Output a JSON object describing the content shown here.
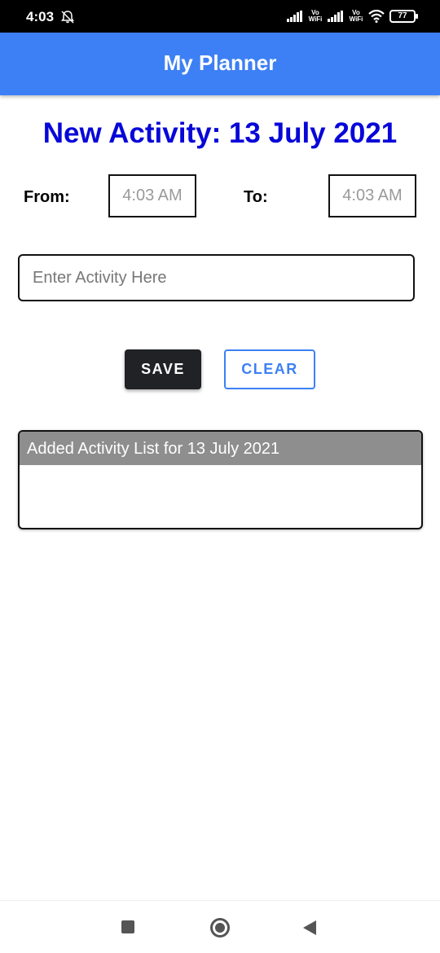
{
  "status_bar": {
    "time": "4:03",
    "vowifi_1": "Vo\nWiFi",
    "vowifi_2": "Vo\nWiFi",
    "battery": "77",
    "icons": [
      "bell-off-icon",
      "signal-icon",
      "wifi-icon",
      "battery-icon"
    ]
  },
  "app_bar": {
    "title": "My Planner",
    "color": "#3d80f5"
  },
  "heading": {
    "text": "New Activity: 13 July 2021",
    "color": "#0707d9"
  },
  "time_range": {
    "from_label": "From:",
    "from_value": "4:03 AM",
    "to_label": "To:",
    "to_value": "4:03 AM"
  },
  "activity_input": {
    "placeholder": "Enter Activity Here",
    "value": ""
  },
  "buttons": {
    "save_label": "SAVE",
    "clear_label": "CLEAR"
  },
  "activity_list": {
    "header": "Added Activity List for 13 July 2021",
    "items": []
  },
  "nav_bar": {
    "icons": [
      "recents-square-icon",
      "home-circle-icon",
      "back-triangle-icon"
    ]
  }
}
